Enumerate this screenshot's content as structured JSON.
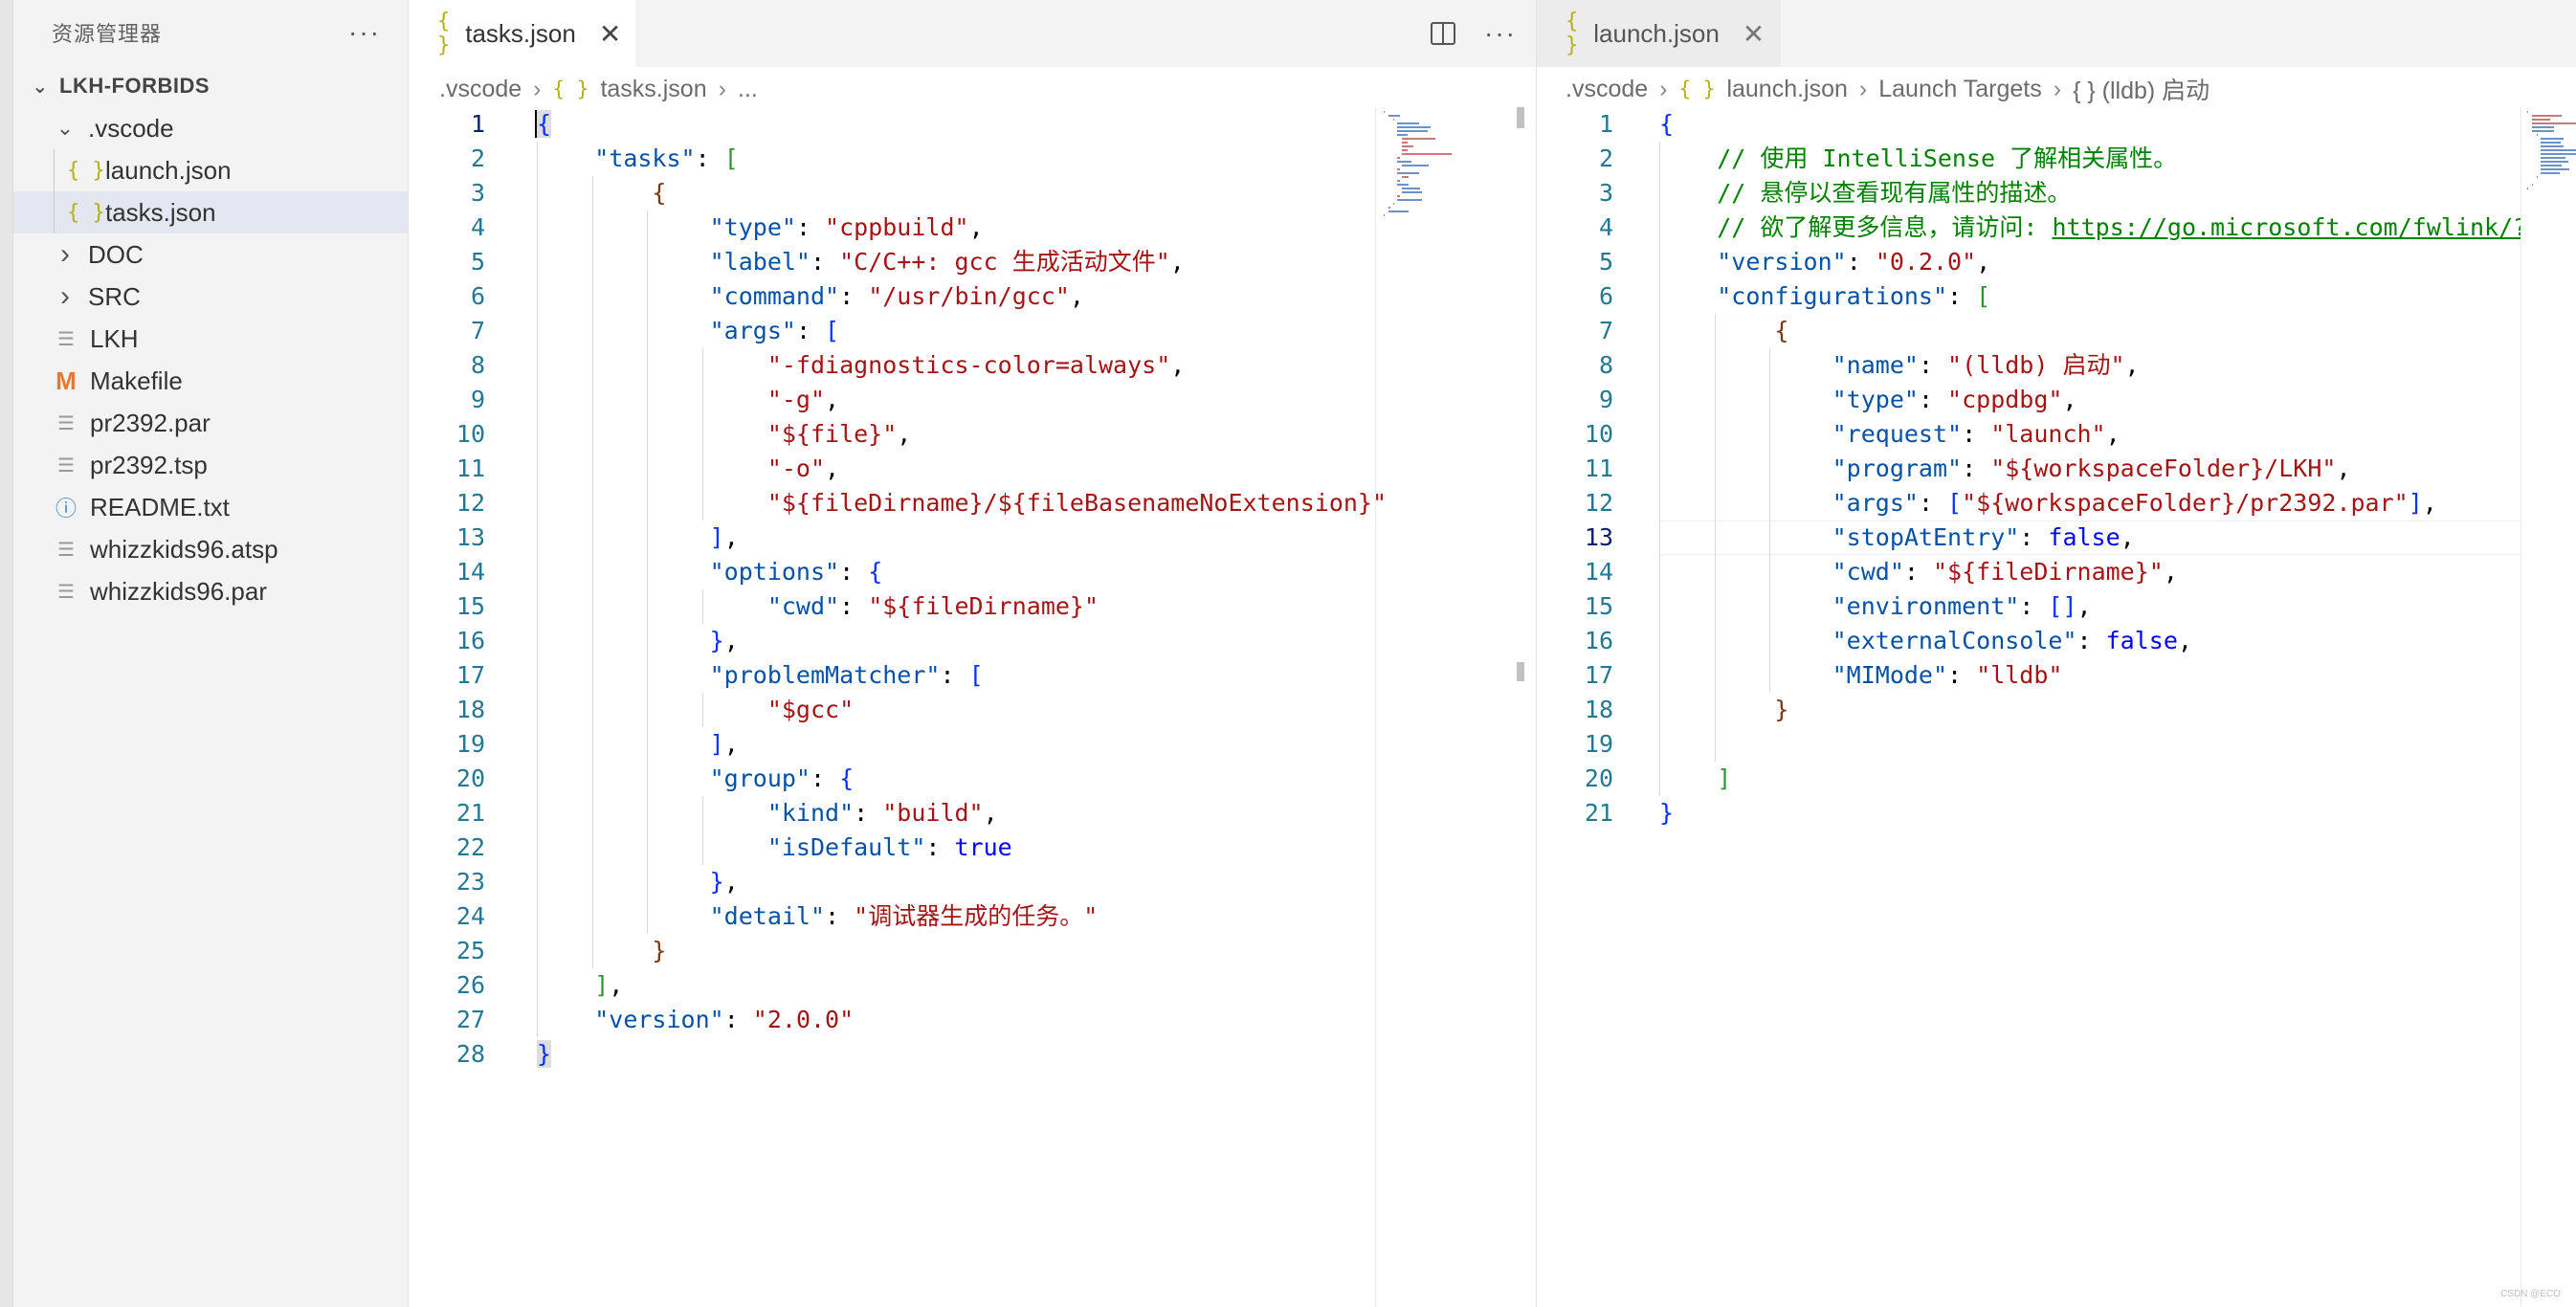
{
  "sidebar": {
    "title": "资源管理器",
    "more_label": "···",
    "root": "LKH-FORBIDS",
    "items": [
      {
        "label": ".vscode",
        "kind": "folder",
        "expanded": true,
        "depth": 1
      },
      {
        "label": "launch.json",
        "kind": "json",
        "depth": 2
      },
      {
        "label": "tasks.json",
        "kind": "json",
        "depth": 2,
        "selected": true
      },
      {
        "label": "DOC",
        "kind": "folder",
        "expanded": false,
        "depth": 1
      },
      {
        "label": "SRC",
        "kind": "folder",
        "expanded": false,
        "depth": 1
      },
      {
        "label": "LKH",
        "kind": "file",
        "depth": 1
      },
      {
        "label": "Makefile",
        "kind": "makefile",
        "depth": 1
      },
      {
        "label": "pr2392.par",
        "kind": "file",
        "depth": 1
      },
      {
        "label": "pr2392.tsp",
        "kind": "file",
        "depth": 1
      },
      {
        "label": "README.txt",
        "kind": "info",
        "depth": 1
      },
      {
        "label": "whizzkids96.atsp",
        "kind": "file",
        "depth": 1
      },
      {
        "label": "whizzkids96.par",
        "kind": "file",
        "depth": 1
      }
    ]
  },
  "left_editor": {
    "tab_label": "tasks.json",
    "tab_icon_glyph": "{ }",
    "close_glyph": "✕",
    "more_label": "···",
    "breadcrumb": [
      ".vscode",
      "tasks.json",
      "..."
    ],
    "active_line": 1
  },
  "right_editor": {
    "tab_label": "launch.json",
    "tab_icon_glyph": "{ }",
    "close_glyph": "✕",
    "breadcrumb": [
      ".vscode",
      "launch.json",
      "Launch Targets",
      "{ } (lldb) 启动"
    ],
    "active_line": 13
  },
  "watermark": "CSDN @ECO",
  "colors": {
    "key": "#0451a5",
    "string": "#a31515",
    "comment": "#008000",
    "keyword": "#0000ff",
    "line_number": "#237893",
    "json_icon": "#b7b01a",
    "makefile_icon": "#e37933",
    "info_icon": "#3c87c8"
  }
}
